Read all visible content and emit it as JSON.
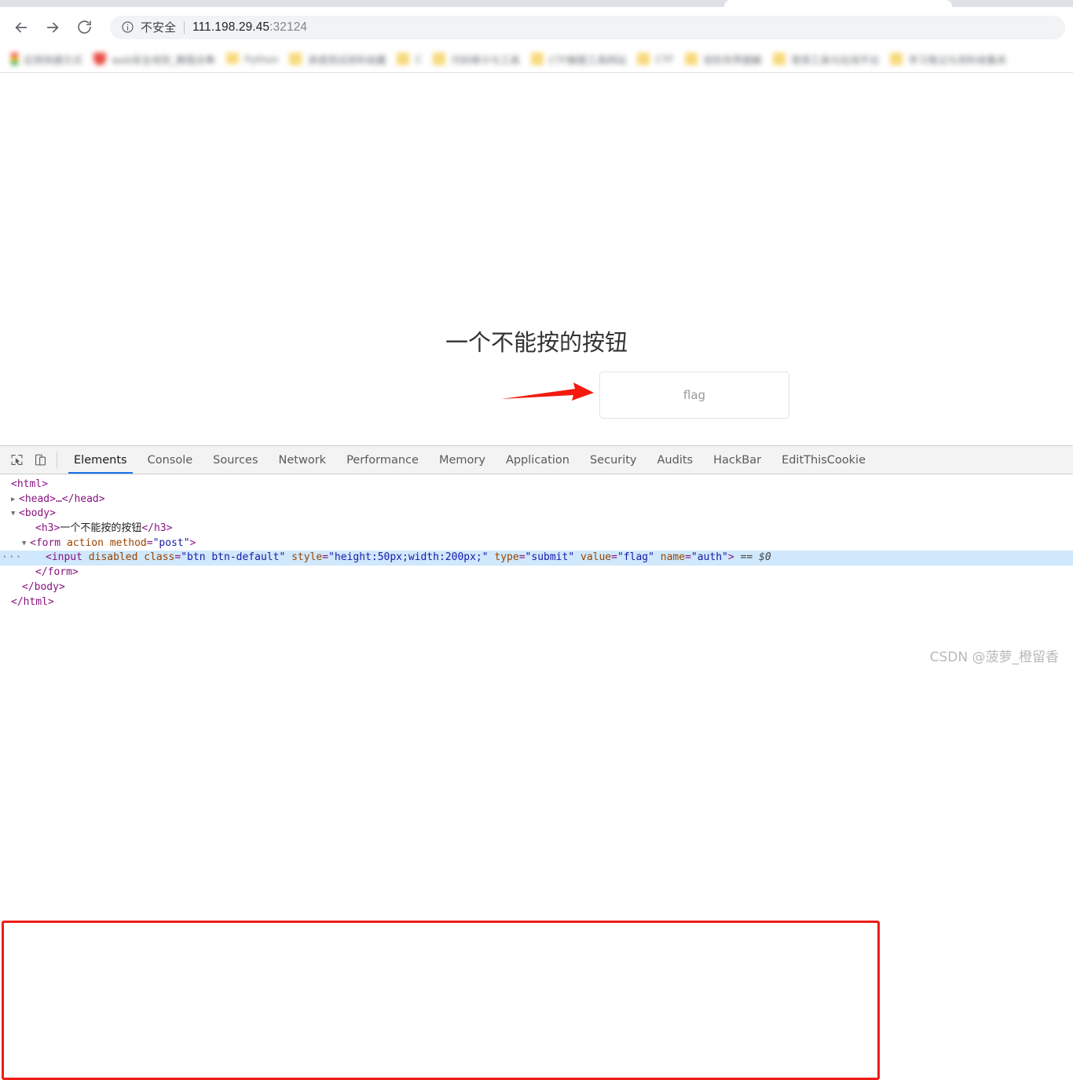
{
  "browser": {
    "back_label": "back-arrow",
    "forward_label": "forward-arrow",
    "reload_label": "reload",
    "security_icon": "info-circle-icon",
    "security_text": "不安全",
    "url_host": "111.198.29.45",
    "url_port": ":32124",
    "bookmarks": [
      {
        "favicon": "chrome",
        "label": "应用快捷方式"
      },
      {
        "favicon": "red",
        "label": "web安全攻防_教程合集"
      },
      {
        "favicon": "yellow",
        "label": "Python"
      },
      {
        "favicon": "yellow",
        "label": "渗透测试资料收藏"
      },
      {
        "favicon": "yellow",
        "label": "C"
      },
      {
        "favicon": "yellow",
        "label": "代码审计与工具"
      },
      {
        "favicon": "yellow",
        "label": "CTF解题工具网站"
      },
      {
        "favicon": "yellow",
        "label": "CTF"
      },
      {
        "favicon": "yellow",
        "label": "攻防世界题解"
      },
      {
        "favicon": "yellow",
        "label": "常用工具与在线平台"
      },
      {
        "favicon": "yellow",
        "label": "学习笔记与资料收集夹"
      }
    ]
  },
  "page": {
    "heading": "一个不能按的按钮",
    "button_value": "flag",
    "annotation": "red-arrow-pointing-to-button"
  },
  "devtools": {
    "inspect_icon": "inspect-element-icon",
    "device_icon": "device-toolbar-icon",
    "tabs": [
      {
        "label": "Elements",
        "active": true
      },
      {
        "label": "Console",
        "active": false
      },
      {
        "label": "Sources",
        "active": false
      },
      {
        "label": "Network",
        "active": false
      },
      {
        "label": "Performance",
        "active": false
      },
      {
        "label": "Memory",
        "active": false
      },
      {
        "label": "Application",
        "active": false
      },
      {
        "label": "Security",
        "active": false
      },
      {
        "label": "Audits",
        "active": false
      },
      {
        "label": "HackBar",
        "active": false
      },
      {
        "label": "EditThisCookie",
        "active": false
      }
    ],
    "dom": {
      "line_html_open": "<html>",
      "line_head": "<head>…</head>",
      "line_body_open": "<body>",
      "line_h3_open": "<h3>",
      "line_h3_text": "一个不能按的按钮",
      "line_h3_close": "</h3>",
      "line_form_open_tag": "<form",
      "line_form_attr_action": "action",
      "line_form_attr_method": "method",
      "line_form_val_method": "\"post\"",
      "line_form_close_bracket": ">",
      "input": {
        "gutter": "···",
        "tag": "<input",
        "attr_disabled": "disabled",
        "attr_class": "class",
        "val_class": "\"btn btn-default\"",
        "attr_style": "style",
        "val_style": "\"height:50px;width:200px;\"",
        "attr_type": "type",
        "val_type": "\"submit\"",
        "attr_value": "value",
        "val_value": "\"flag\"",
        "attr_name": "name",
        "val_name": "\"auth\"",
        "close_bracket": ">",
        "selected_ref": "== $0"
      },
      "line_form_close": "</form>",
      "line_body_close": "</body>",
      "line_html_close": "</html>"
    }
  },
  "watermark": "CSDN @菠萝_橙留香",
  "colors": {
    "accent_blue": "#1a73e8",
    "selection_blue": "#cfe8fc",
    "annotation_red": "#ee1c18",
    "tag_purple": "#881280",
    "attr_orange": "#994500",
    "value_blue": "#1a1aa6"
  }
}
